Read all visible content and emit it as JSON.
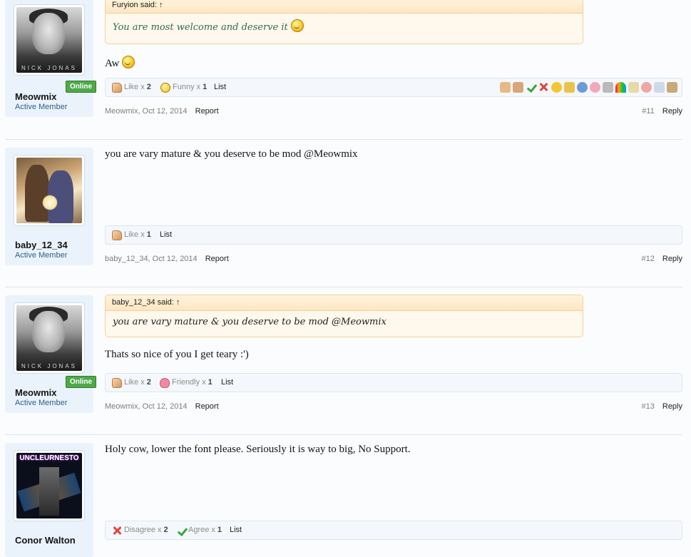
{
  "posts": [
    {
      "id": 11,
      "author": "Meowmix",
      "user_title": "Active Member",
      "online_label": "Online",
      "avatar_caption": "NICK JONAS",
      "quote": {
        "author_line": "Furyion said: ↑",
        "text": "You are most welcome and deserve it"
      },
      "message": "Aw",
      "ratings": [
        {
          "name": "Like",
          "sep": "x",
          "count": "2"
        },
        {
          "name": "Funny",
          "sep": "x",
          "count": "1"
        }
      ],
      "ratings_list_label": "List",
      "meta": {
        "author_date": "Meowmix, Oct 12, 2014",
        "report": "Report",
        "number": "#11",
        "reply": "Reply"
      }
    },
    {
      "id": 12,
      "author": "baby_12_34",
      "user_title": "Active Member",
      "message": "you are vary mature & you deserve to be mod @Meowmix",
      "ratings": [
        {
          "name": "Like",
          "sep": "x",
          "count": "1"
        }
      ],
      "ratings_list_label": "List",
      "meta": {
        "author_date": "baby_12_34, Oct 12, 2014",
        "report": "Report",
        "number": "#12",
        "reply": "Reply"
      }
    },
    {
      "id": 13,
      "author": "Meowmix",
      "user_title": "Active Member",
      "online_label": "Online",
      "avatar_caption": "NICK JONAS",
      "quote": {
        "author_line": "baby_12_34 said: ↑",
        "text": "you are vary mature & you deserve to be mod @Meowmix"
      },
      "message": "Thats so nice of you I get teary :')",
      "ratings": [
        {
          "name": "Like",
          "sep": "x",
          "count": "2"
        },
        {
          "name": "Friendly",
          "sep": "x",
          "count": "1"
        }
      ],
      "ratings_list_label": "List",
      "meta": {
        "author_date": "Meowmix, Oct 12, 2014",
        "report": "Report",
        "number": "#13",
        "reply": "Reply"
      }
    },
    {
      "id": 14,
      "author": "Conor Walton",
      "avatar_caption": "UNCLEURNESTO",
      "message": "Holy cow, lower the font please. Seriously it is way to big, No Support.",
      "ratings": [
        {
          "name": "Disagree",
          "sep": "x",
          "count": "2"
        },
        {
          "name": "Agree",
          "sep": "x",
          "count": "1"
        }
      ],
      "ratings_list_label": "List"
    }
  ],
  "rating_tool_icons": [
    "like-icon",
    "dislike-icon",
    "agree-icon",
    "disagree-icon",
    "funny-icon",
    "winner-icon",
    "informative-icon",
    "friendly-icon",
    "useful-icon",
    "creative-icon",
    "optimistic-icon",
    "late-icon",
    "spelling-icon",
    "box-icon"
  ],
  "colors": {
    "online_badge": "#4fa94a",
    "quote_border": "#f5cf9b",
    "user_title": "#2d5e8e"
  }
}
